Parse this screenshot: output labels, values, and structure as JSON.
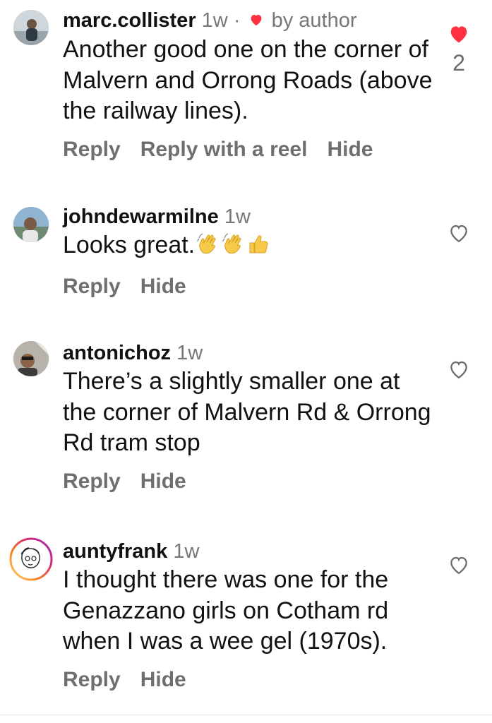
{
  "comments": [
    {
      "username": "marc.collister",
      "time": "1w",
      "separator": "·",
      "liked_by_author_label": "by author",
      "text": "Another good one on the corner of Malvern and Orrong Roads (above the railway lines).",
      "actions": [
        "Reply",
        "Reply with a reel",
        "Hide"
      ],
      "liked": true,
      "like_count": "2",
      "avatar_icon": "profile-photo",
      "heart_color": "#ff3040"
    },
    {
      "username": "johndewarmilne",
      "time": "1w",
      "text": "Looks great.",
      "emojis": [
        "waving-hand-icon",
        "waving-hand-icon",
        "thumbs-up-icon"
      ],
      "actions": [
        "Reply",
        "Hide"
      ],
      "liked": false,
      "avatar_icon": "profile-photo"
    },
    {
      "username": "antonichoz",
      "time": "1w",
      "text": "There’s a slightly smaller one at the corner of Malvern Rd & Orrong Rd tram stop",
      "actions": [
        "Reply",
        "Hide"
      ],
      "liked": false,
      "avatar_icon": "profile-photo"
    },
    {
      "username": "auntyfrank",
      "time": "1w",
      "text": "I thought there was one for the Genazzano girls on Cotham rd when I was a wee gel (1970s).",
      "actions": [
        "Reply",
        "Hide"
      ],
      "liked": false,
      "avatar_icon": "cartoon-avatar-with-story-ring",
      "story_ring_colors": [
        "#feda75",
        "#fa7e1e",
        "#d62976",
        "#962fbf"
      ]
    }
  ],
  "colors": {
    "text": "#111111",
    "secondary": "#777777",
    "action": "#6f6f6f",
    "like_active": "#ff3040"
  }
}
